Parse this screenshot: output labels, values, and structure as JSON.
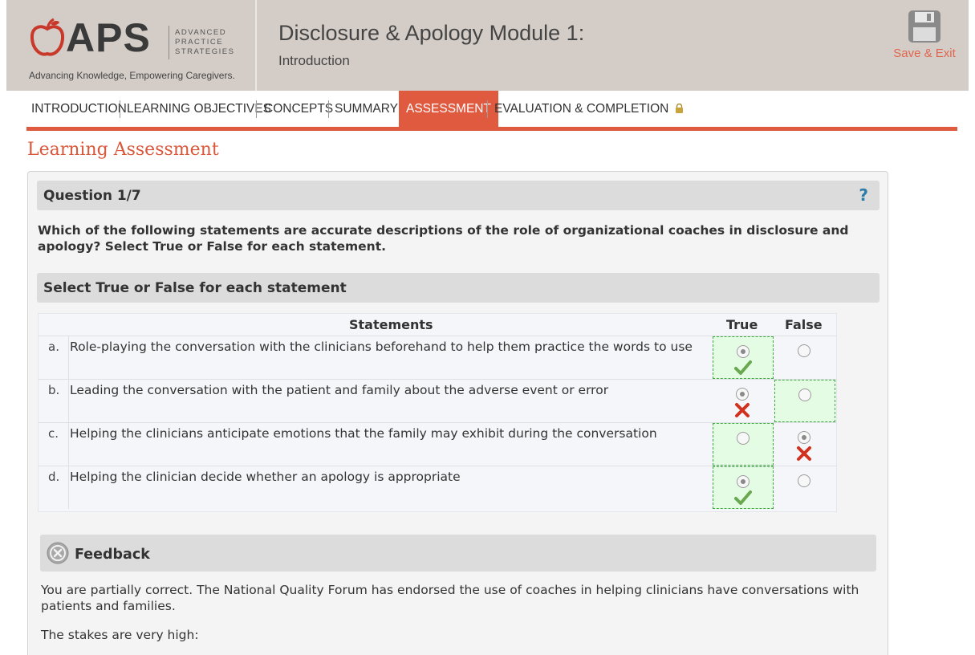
{
  "brand": {
    "logo_text": "APS",
    "logo_sub": [
      "ADVANCED",
      "PRACTICE",
      "STRATEGIES"
    ],
    "tagline": "Advancing Knowledge, Empowering Caregivers.",
    "accent_color": "#e05a40"
  },
  "header": {
    "title": "Disclosure & Apology Module 1:",
    "subtitle": "Introduction",
    "save_label": "Save & Exit"
  },
  "nav": {
    "items": [
      {
        "label": "INTRODUCTION",
        "active": false
      },
      {
        "label": "LEARNING OBJECTIVES",
        "active": false
      },
      {
        "label": "CONCEPTS",
        "active": false
      },
      {
        "label": "SUMMARY",
        "active": false
      },
      {
        "label": "ASSESSMENT",
        "active": true
      },
      {
        "label": "EVALUATION & COMPLETION",
        "active": false,
        "icon": "lock-icon"
      }
    ]
  },
  "page": {
    "title": "Learning Assessment"
  },
  "question": {
    "label": "Question 1/7",
    "help": "?",
    "text": "Which of the following statements are accurate descriptions of the role of organizational coaches in disclosure and apology? Select True or False for each statement.",
    "instruction": "Select True or False for each statement"
  },
  "table": {
    "headers": {
      "statements": "Statements",
      "true": "True",
      "false": "False"
    },
    "rows": [
      {
        "letter": "a.",
        "text": "Role-playing the conversation with the clinicians beforehand to help them practice the words to use",
        "selected": "true",
        "correct": "true",
        "result": "check"
      },
      {
        "letter": "b.",
        "text": "Leading the conversation with the patient and family about the adverse event or error",
        "selected": "true",
        "correct": "false",
        "result": "cross"
      },
      {
        "letter": "c.",
        "text": "Helping the clinicians anticipate emotions that the family may exhibit during the conversation",
        "selected": "false",
        "correct": "true",
        "result": "cross"
      },
      {
        "letter": "d.",
        "text": "Helping the clinician decide whether an apology is appropriate",
        "selected": "true",
        "correct": "true",
        "result": "check"
      }
    ]
  },
  "feedback": {
    "label": "Feedback",
    "text": "You are partially correct. The National Quality Forum has endorsed the use of coaches in helping clinicians have conversations with patients and families.",
    "text2": "The stakes are very high:"
  }
}
